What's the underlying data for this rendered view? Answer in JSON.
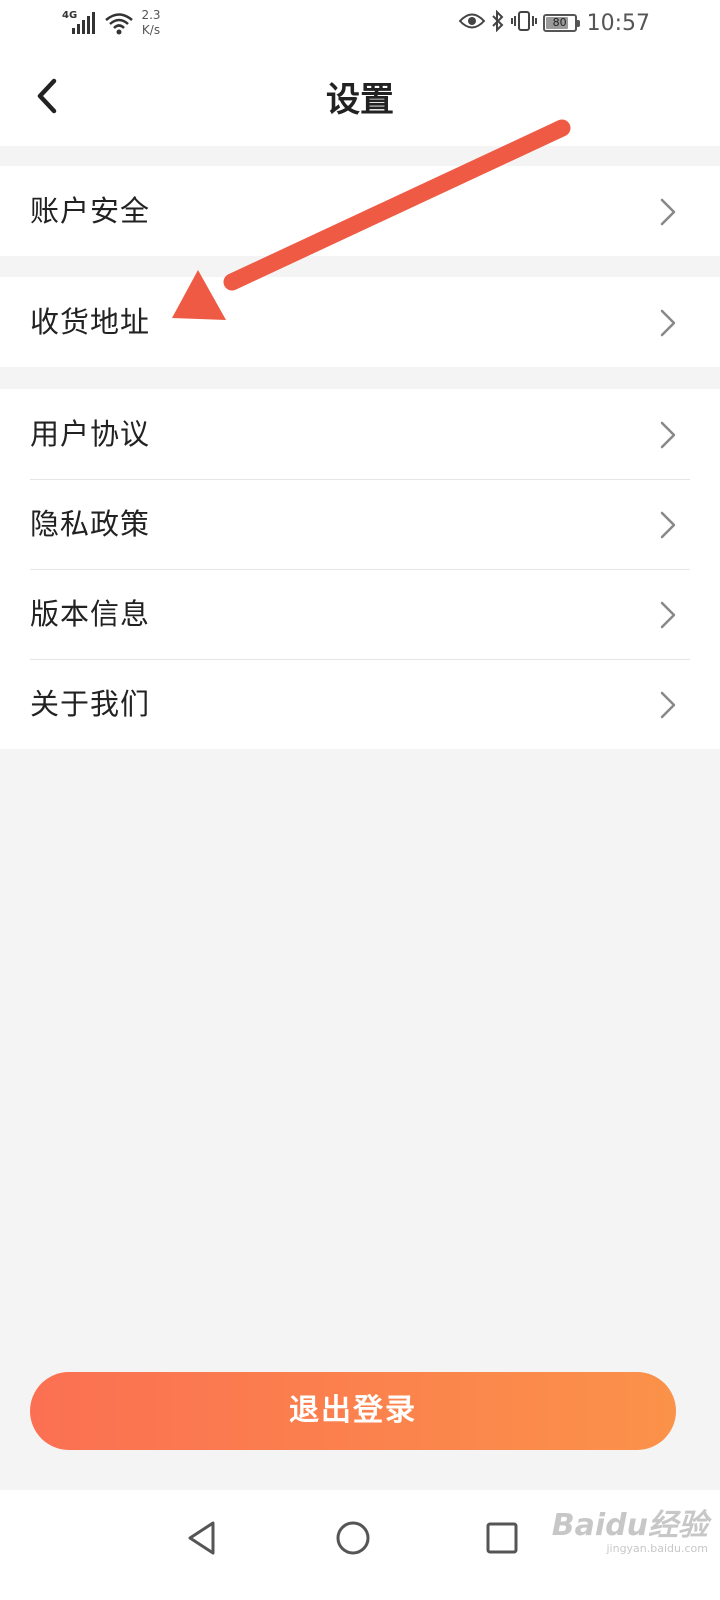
{
  "status_bar": {
    "network": "4G",
    "speed_value": "2.3",
    "speed_unit": "K/s",
    "battery": "80",
    "battery_level": 0.8,
    "time": "10:57"
  },
  "header": {
    "title": "设置"
  },
  "settings_groups": [
    {
      "items": [
        {
          "label": "账户安全"
        }
      ]
    },
    {
      "items": [
        {
          "label": "收货地址"
        }
      ]
    },
    {
      "items": [
        {
          "label": "用户协议"
        },
        {
          "label": "隐私政策"
        },
        {
          "label": "版本信息"
        },
        {
          "label": "关于我们"
        }
      ]
    }
  ],
  "logout": {
    "label": "退出登录"
  },
  "watermark": {
    "logo": "Baidu经验",
    "url": "jingyan.baidu.com"
  },
  "colors": {
    "accent_start": "#fb7052",
    "accent_end": "#fb9249",
    "annotation_arrow": "#ee5a43"
  },
  "icons": {
    "back": "chevron-left-icon",
    "row_arrow": "chevron-right-icon",
    "nav_back": "triangle-back-icon",
    "nav_home": "circle-home-icon",
    "nav_recent": "square-recent-icon"
  }
}
